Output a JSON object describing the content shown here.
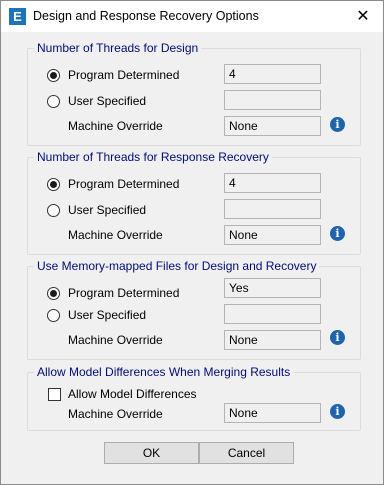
{
  "window": {
    "title": "Design and Response Recovery Options",
    "app_icon_letter": "E",
    "close_glyph": "✕"
  },
  "groups": [
    {
      "title": "Number of Threads for Design",
      "options": [
        "Program Determined",
        "User Specified"
      ],
      "selected": "Program Determined",
      "program_value": "4",
      "user_value": "",
      "override_label": "Machine Override",
      "override_value": "None"
    },
    {
      "title": "Number of Threads for Response Recovery",
      "options": [
        "Program Determined",
        "User Specified"
      ],
      "selected": "Program Determined",
      "program_value": "4",
      "user_value": "",
      "override_label": "Machine Override",
      "override_value": "None"
    },
    {
      "title": "Use Memory-mapped Files for Design and Recovery",
      "options": [
        "Program Determined",
        "User Specified"
      ],
      "selected": "Program Determined",
      "program_value": "Yes",
      "user_value": "",
      "override_label": "Machine Override",
      "override_value": "None"
    },
    {
      "title": "Allow Model Differences When Merging Results",
      "checkbox_label": "Allow Model Differences",
      "checkbox_checked": false,
      "override_label": "Machine Override",
      "override_value": "None"
    }
  ],
  "info_glyph": "i",
  "buttons": {
    "ok": "OK",
    "cancel": "Cancel"
  },
  "colors": {
    "group_title": "#000a80",
    "info_icon": "#1e63ad",
    "app_icon": "#1b75bc"
  }
}
